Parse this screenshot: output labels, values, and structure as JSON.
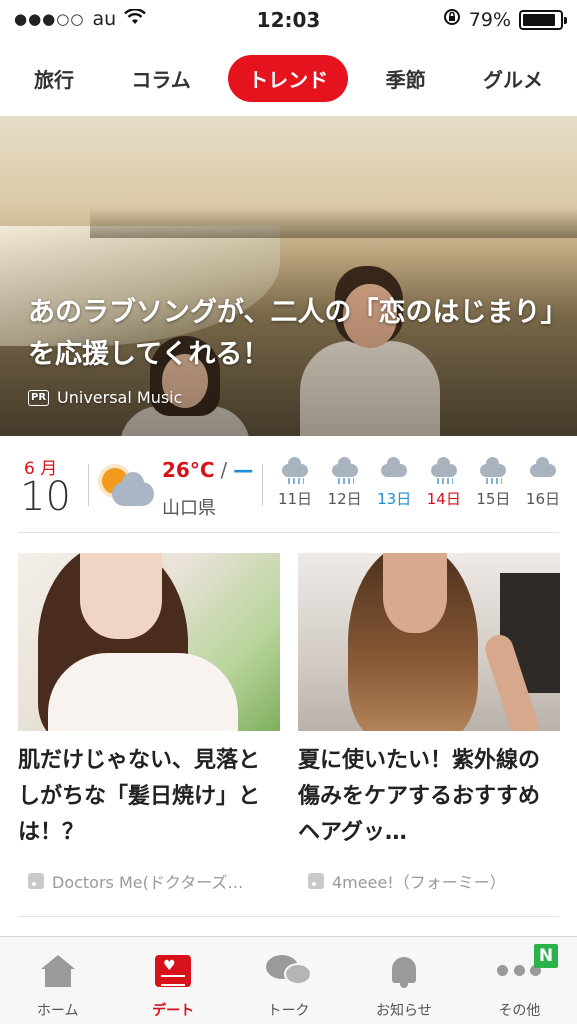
{
  "status_bar": {
    "signal": "●●●○○",
    "carrier": "au",
    "time": "12:03",
    "battery_percent": "79%",
    "battery_level": 0.79
  },
  "tabs": [
    {
      "label": "旅行",
      "active": false
    },
    {
      "label": "コラム",
      "active": false
    },
    {
      "label": "トレンド",
      "active": true
    },
    {
      "label": "季節",
      "active": false
    },
    {
      "label": "グルメ",
      "active": false
    }
  ],
  "hero": {
    "title": "あのラブソングが、二人の「恋のはじまり」を応援してくれる！",
    "pr_badge": "PR",
    "sponsor": "Universal Music"
  },
  "weather": {
    "month": "6 月",
    "day": "10",
    "temp_high": "26°C",
    "separator": "/",
    "temp_low": "—",
    "prefecture": "山口県",
    "forecast": [
      {
        "label": "11日",
        "icon": "cloud-rain-icon",
        "kind": "weekday"
      },
      {
        "label": "12日",
        "icon": "cloud-rain-icon",
        "kind": "weekday"
      },
      {
        "label": "13日",
        "icon": "cloud-icon",
        "kind": "saturday"
      },
      {
        "label": "14日",
        "icon": "cloud-rain-icon",
        "kind": "sunday"
      },
      {
        "label": "15日",
        "icon": "cloud-rain-icon",
        "kind": "weekday"
      },
      {
        "label": "16日",
        "icon": "cloud-icon",
        "kind": "weekday"
      }
    ]
  },
  "articles": [
    {
      "title": "肌だけじゃない、見落としがちな「髪日焼け」とは！？",
      "source": "Doctors Me(ドクターズ…"
    },
    {
      "title": "夏に使いたい！紫外線の傷みをケアするおすすめヘアグッ…",
      "source": "4meee!（フォーミー）"
    }
  ],
  "navbar": {
    "items": [
      {
        "label": "ホーム",
        "icon": "home-icon",
        "active": false
      },
      {
        "label": "デート",
        "icon": "date-icon",
        "active": true
      },
      {
        "label": "トーク",
        "icon": "talk-icon",
        "active": false
      },
      {
        "label": "お知らせ",
        "icon": "bell-icon",
        "active": false
      },
      {
        "label": "その他",
        "icon": "more-icon",
        "active": false
      }
    ],
    "badge": "N"
  },
  "colors": {
    "accent": "#e4131d",
    "saturday": "#1a8fd4",
    "badge": "#2cb24a"
  }
}
